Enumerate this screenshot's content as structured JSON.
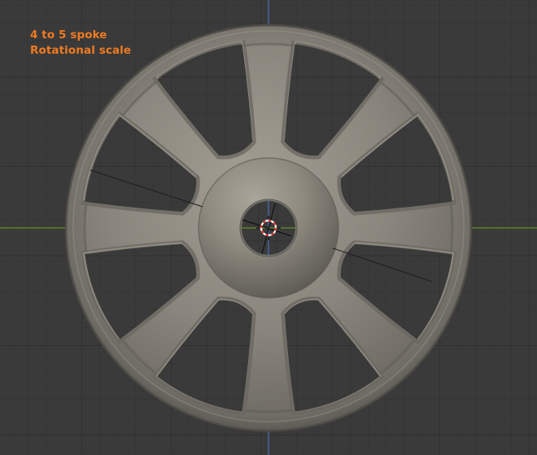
{
  "viewport": {
    "annotation": {
      "line1": "4 to 5 spoke",
      "line2": "Rotational scale"
    },
    "colors": {
      "background": "#3a3a3a",
      "grid_minor": "#343434",
      "grid_major": "#2b2b2b",
      "axis_x": "#6a8e2a",
      "axis_y": "#4a6fb5",
      "annotation": "#f07a22",
      "model_base": "#8c887f"
    },
    "icons": {
      "cursor": "3d-cursor-icon"
    }
  }
}
